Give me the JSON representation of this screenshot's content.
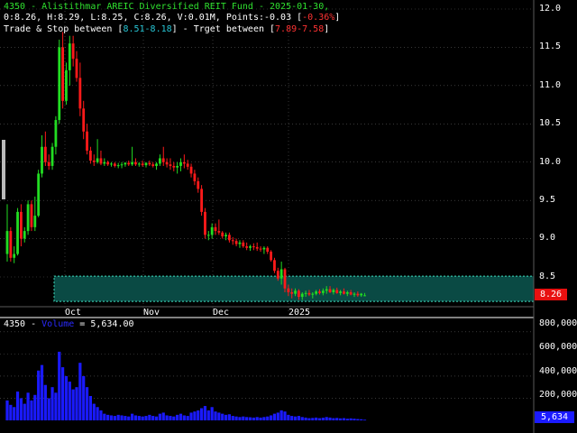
{
  "header": {
    "symbol": "4350",
    "title_line": "4350 - Alistithmar AREIC Diversified REIT Fund - 2025-01-30,",
    "ohlc_prefix": "0:8.26, H:8.29, L:8.25, C:8.26, V:0.01M, Points:-0.03 [",
    "change_pct": "-0.36%",
    "ohlc_suffix": "]",
    "trade_label": "Trade & Stop between [",
    "trade_range": "8.51-8.18",
    "target_label": "] - Trget between [",
    "target_range": "7.89-7.58",
    "target_suffix": "]"
  },
  "volume_header": {
    "prefix": "4350 - ",
    "label": "Volume",
    "value_text": " = 5,634.00"
  },
  "price_axis": {
    "ticks": [
      "12.0",
      "11.5",
      "11.0",
      "10.5",
      "10.0",
      "9.5",
      "9.0",
      "8.5"
    ],
    "last_price": "8.26"
  },
  "date_axis": {
    "ticks": [
      "Oct",
      "Nov",
      "Dec",
      "2025"
    ]
  },
  "volume_axis": {
    "ticks": [
      "800,000",
      "600,000",
      "400,000",
      "200,000"
    ],
    "last_volume": "5,634"
  },
  "colors": {
    "up": "#22dd22",
    "down": "#ff1a1a",
    "volume": "#1a1aff",
    "zone_fill": "#0a4a44",
    "zone_border": "#3fe0c0",
    "grid": "#5a5a5a",
    "title": "#2fe02f",
    "background": "#000000"
  },
  "chart_data": {
    "type": "candlestick",
    "ylim": [
      8.2,
      12.1
    ],
    "volume_ylim": [
      0,
      880000
    ],
    "trade_zone": [
      8.18,
      8.51
    ],
    "candles": [
      [
        8.8,
        9.45,
        8.7,
        9.1,
        180000
      ],
      [
        9.1,
        9.15,
        8.7,
        8.75,
        140000
      ],
      [
        8.75,
        8.9,
        8.68,
        8.8,
        120000
      ],
      [
        8.8,
        9.4,
        8.78,
        9.35,
        260000
      ],
      [
        9.35,
        9.45,
        8.9,
        9.0,
        200000
      ],
      [
        9.0,
        9.15,
        8.95,
        9.1,
        150000
      ],
      [
        9.1,
        9.5,
        9.05,
        9.45,
        250000
      ],
      [
        9.45,
        9.5,
        9.1,
        9.15,
        180000
      ],
      [
        9.15,
        9.55,
        9.1,
        9.3,
        230000
      ],
      [
        9.3,
        9.9,
        9.28,
        9.85,
        450000
      ],
      [
        9.85,
        10.35,
        9.8,
        10.2,
        500000
      ],
      [
        10.2,
        10.4,
        9.95,
        10.0,
        320000
      ],
      [
        10.0,
        10.1,
        9.9,
        9.95,
        200000
      ],
      [
        9.95,
        10.25,
        9.9,
        10.2,
        300000
      ],
      [
        10.2,
        10.6,
        10.1,
        10.55,
        250000
      ],
      [
        10.55,
        11.6,
        10.5,
        11.5,
        620000
      ],
      [
        11.5,
        11.7,
        10.7,
        10.8,
        480000
      ],
      [
        10.8,
        11.3,
        10.75,
        11.2,
        400000
      ],
      [
        11.2,
        11.65,
        11.0,
        11.55,
        350000
      ],
      [
        11.55,
        11.65,
        11.25,
        11.35,
        280000
      ],
      [
        11.35,
        11.45,
        11.05,
        11.1,
        300000
      ],
      [
        11.1,
        11.3,
        10.6,
        10.7,
        520000
      ],
      [
        10.7,
        10.8,
        10.3,
        10.4,
        400000
      ],
      [
        10.4,
        10.5,
        10.1,
        10.15,
        300000
      ],
      [
        10.15,
        10.2,
        9.98,
        10.02,
        220000
      ],
      [
        10.02,
        10.1,
        9.95,
        10.0,
        150000
      ],
      [
        10.0,
        10.3,
        9.98,
        10.05,
        120000
      ],
      [
        10.05,
        10.15,
        9.96,
        9.98,
        90000
      ],
      [
        9.98,
        10.05,
        9.95,
        10.0,
        60000
      ],
      [
        10.0,
        10.02,
        9.95,
        9.97,
        50000
      ],
      [
        9.97,
        10.0,
        9.94,
        9.98,
        45000
      ],
      [
        9.98,
        10.0,
        9.93,
        9.95,
        40000
      ],
      [
        9.95,
        9.99,
        9.92,
        9.96,
        50000
      ],
      [
        9.96,
        10.0,
        9.92,
        9.97,
        45000
      ],
      [
        9.97,
        10.0,
        9.94,
        9.99,
        40000
      ],
      [
        9.99,
        10.02,
        9.95,
        9.97,
        35000
      ],
      [
        9.97,
        10.2,
        9.95,
        10.0,
        60000
      ],
      [
        10.0,
        10.05,
        9.95,
        9.97,
        45000
      ],
      [
        9.97,
        10.0,
        9.94,
        9.98,
        40000
      ],
      [
        9.98,
        10.02,
        9.94,
        9.96,
        35000
      ],
      [
        9.96,
        10.0,
        9.93,
        9.99,
        40000
      ],
      [
        9.99,
        10.02,
        9.95,
        9.97,
        50000
      ],
      [
        9.97,
        10.0,
        9.93,
        9.95,
        40000
      ],
      [
        9.95,
        10.0,
        9.9,
        9.98,
        35000
      ],
      [
        9.98,
        10.1,
        9.95,
        10.05,
        60000
      ],
      [
        10.05,
        10.2,
        9.95,
        10.0,
        70000
      ],
      [
        10.0,
        10.05,
        9.93,
        9.97,
        45000
      ],
      [
        9.97,
        10.05,
        9.9,
        9.95,
        40000
      ],
      [
        9.95,
        10.0,
        9.88,
        9.93,
        35000
      ],
      [
        9.93,
        10.0,
        9.85,
        9.95,
        50000
      ],
      [
        9.95,
        10.05,
        9.88,
        10.0,
        60000
      ],
      [
        10.0,
        10.1,
        9.92,
        9.98,
        45000
      ],
      [
        9.98,
        10.03,
        9.9,
        9.94,
        40000
      ],
      [
        9.94,
        9.98,
        9.8,
        9.85,
        70000
      ],
      [
        9.85,
        9.9,
        9.7,
        9.75,
        80000
      ],
      [
        9.75,
        9.8,
        9.6,
        9.65,
        90000
      ],
      [
        9.65,
        9.7,
        9.3,
        9.35,
        110000
      ],
      [
        9.35,
        9.4,
        9.0,
        9.05,
        130000
      ],
      [
        9.05,
        9.1,
        8.98,
        9.05,
        90000
      ],
      [
        9.05,
        9.2,
        9.0,
        9.15,
        120000
      ],
      [
        9.15,
        9.2,
        9.05,
        9.1,
        80000
      ],
      [
        9.1,
        9.25,
        9.05,
        9.08,
        70000
      ],
      [
        9.08,
        9.1,
        9.0,
        9.03,
        60000
      ],
      [
        9.03,
        9.08,
        8.98,
        9.05,
        50000
      ],
      [
        9.05,
        9.08,
        8.95,
        8.98,
        55000
      ],
      [
        8.98,
        9.02,
        8.92,
        8.97,
        40000
      ],
      [
        8.97,
        9.0,
        8.9,
        8.93,
        35000
      ],
      [
        8.93,
        8.98,
        8.88,
        8.95,
        30000
      ],
      [
        8.95,
        8.98,
        8.88,
        8.9,
        35000
      ],
      [
        8.9,
        8.95,
        8.85,
        8.88,
        30000
      ],
      [
        8.88,
        8.92,
        8.84,
        8.9,
        28000
      ],
      [
        8.9,
        8.94,
        8.85,
        8.89,
        25000
      ],
      [
        8.89,
        8.95,
        8.84,
        8.87,
        30000
      ],
      [
        8.87,
        8.9,
        8.83,
        8.86,
        25000
      ],
      [
        8.86,
        8.9,
        8.8,
        8.88,
        30000
      ],
      [
        8.88,
        8.9,
        8.8,
        8.83,
        35000
      ],
      [
        8.83,
        8.85,
        8.7,
        8.72,
        45000
      ],
      [
        8.72,
        8.75,
        8.55,
        8.58,
        60000
      ],
      [
        8.58,
        8.62,
        8.45,
        8.48,
        70000
      ],
      [
        8.48,
        8.7,
        8.4,
        8.6,
        90000
      ],
      [
        8.6,
        8.62,
        8.3,
        8.35,
        80000
      ],
      [
        8.35,
        8.4,
        8.25,
        8.3,
        50000
      ],
      [
        8.3,
        8.35,
        8.22,
        8.28,
        40000
      ],
      [
        8.28,
        8.35,
        8.25,
        8.32,
        35000
      ],
      [
        8.32,
        8.34,
        8.2,
        8.24,
        40000
      ],
      [
        8.24,
        8.3,
        8.2,
        8.28,
        30000
      ],
      [
        8.28,
        8.32,
        8.24,
        8.29,
        25000
      ],
      [
        8.29,
        8.33,
        8.25,
        8.27,
        20000
      ],
      [
        8.27,
        8.3,
        8.22,
        8.28,
        22000
      ],
      [
        8.28,
        8.33,
        8.26,
        8.31,
        25000
      ],
      [
        8.31,
        8.34,
        8.27,
        8.29,
        20000
      ],
      [
        8.29,
        8.35,
        8.26,
        8.32,
        24000
      ],
      [
        8.32,
        8.38,
        8.28,
        8.34,
        30000
      ],
      [
        8.34,
        8.38,
        8.29,
        8.3,
        25000
      ],
      [
        8.3,
        8.35,
        8.27,
        8.33,
        20000
      ],
      [
        8.33,
        8.36,
        8.28,
        8.29,
        22000
      ],
      [
        8.29,
        8.33,
        8.26,
        8.31,
        18000
      ],
      [
        8.31,
        8.35,
        8.27,
        8.28,
        20000
      ],
      [
        8.28,
        8.32,
        8.25,
        8.3,
        15000
      ],
      [
        8.3,
        8.33,
        8.26,
        8.27,
        18000
      ],
      [
        8.27,
        8.3,
        8.24,
        8.28,
        15000
      ],
      [
        8.28,
        8.31,
        8.24,
        8.26,
        12000
      ],
      [
        8.26,
        8.29,
        8.24,
        8.28,
        10000
      ],
      [
        8.26,
        8.29,
        8.25,
        8.26,
        5634
      ]
    ]
  }
}
